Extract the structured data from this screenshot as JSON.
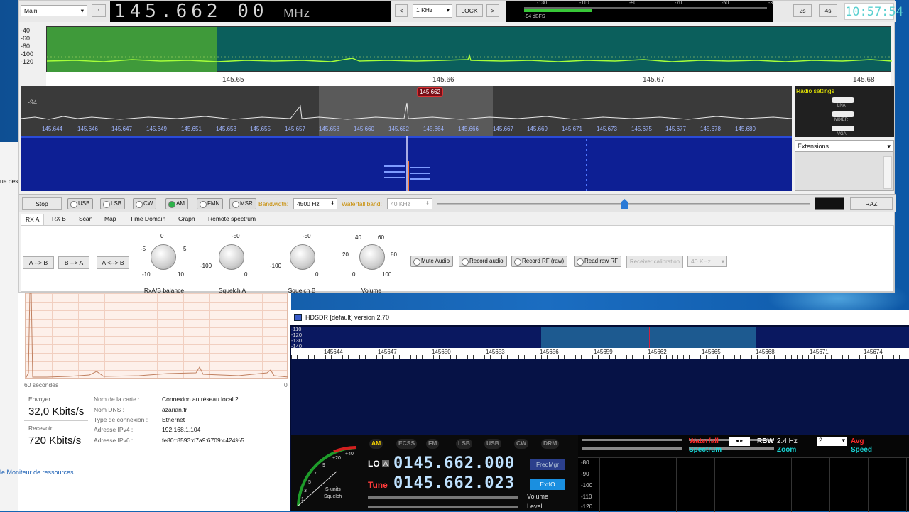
{
  "main_app": {
    "profile_select": "Main",
    "frequency_digits": "145.662 00",
    "frequency_unit": "MHz",
    "step_prev": "<",
    "step_select": "1 KHz",
    "lock_label": "LOCK",
    "step_next": ">",
    "smeter": {
      "scale": [
        "-130",
        "-110",
        "-90",
        "-70",
        "-50",
        "-30"
      ],
      "reading": "-94 dBFS"
    },
    "btn_2s": "2s",
    "btn_4s": "4s",
    "clock": "10:57:54",
    "spectrum1": {
      "y_ticks": [
        "-40",
        "-60",
        "-80",
        "-100",
        "-120"
      ],
      "x_ticks": [
        "145.65",
        "145.66",
        "145.67",
        "145.68"
      ]
    },
    "spectrum2": {
      "level_label": "-94",
      "center_marker": "145.662",
      "x_ticks": [
        "145.644",
        "145.646",
        "145.647",
        "145.649",
        "145.651",
        "145.653",
        "145.655",
        "145.657",
        "145.658",
        "145.660",
        "145.662",
        "145.664",
        "145.666",
        "145.667",
        "145.669",
        "145.671",
        "145.673",
        "145.675",
        "145.677",
        "145.678",
        "145.680"
      ]
    },
    "radio_settings": {
      "title": "Radio settings",
      "items": [
        "LNA",
        "MIXER",
        "VGA"
      ]
    },
    "extensions": "Extensions",
    "controls": {
      "stop": "Stop",
      "modes": [
        "USB",
        "LSB",
        "CW",
        "AM",
        "FMN",
        "MSR"
      ],
      "active_mode": "AM",
      "bandwidth_label": "Bandwidth:",
      "bandwidth_value": "4500 Hz",
      "waterfall_band_label": "Waterfall band:",
      "waterfall_band_value": "40 KHz",
      "raz": "RAZ"
    },
    "tabs": [
      "RX A",
      "RX B",
      "Scan",
      "Map",
      "Time Domain",
      "Graph",
      "Remote spectrum"
    ],
    "rx_buttons": [
      "A --> B",
      "B --> A",
      "A <--> B"
    ],
    "knobs": [
      {
        "label": "RxA/B balance",
        "ticks": [
          "0",
          "-5",
          "5",
          "-10",
          "10"
        ]
      },
      {
        "label": "Squelch A",
        "ticks": [
          "-50",
          "-100",
          "0"
        ]
      },
      {
        "label": "Squelch B",
        "ticks": [
          "-50",
          "-100",
          "0"
        ]
      },
      {
        "label": "Volume",
        "ticks": [
          "40",
          "60",
          "20",
          "80",
          "0",
          "100"
        ]
      }
    ],
    "audio_buttons": [
      "Mute Audio",
      "Record audio",
      "Record RF (raw)",
      "Read raw RF",
      "Receiver calibration",
      "40 KHz"
    ]
  },
  "resource_monitor": {
    "left_cut_label": "ue des",
    "graph_seconds": "60 secondes",
    "graph_zero": "0",
    "send_label": "Envoyer",
    "send_value": "32,0 Kbits/s",
    "receive_label": "Recevoir",
    "receive_value": "720 Kbits/s",
    "info": [
      {
        "k": "Nom de la carte :",
        "v": "Connexion au réseau local 2"
      },
      {
        "k": "Nom DNS :",
        "v": "azarian.fr"
      },
      {
        "k": "Type de connexion :",
        "v": "Ethernet"
      },
      {
        "k": "Adresse IPv4 :",
        "v": "192.168.1.104"
      },
      {
        "k": "Adresse IPv6 :",
        "v": "fe80::8593:d7a9:6709:c424%5"
      }
    ],
    "link": "le Moniteur de ressources"
  },
  "hdsdr": {
    "title": "HDSDR [default]  version 2.70",
    "y_ticks": [
      "-110",
      "-120",
      "-130",
      "-140"
    ],
    "x_ticks": [
      "145644",
      "145647",
      "145650",
      "145653",
      "145656",
      "145659",
      "145662",
      "145665",
      "145668",
      "145671",
      "145674"
    ],
    "modes": [
      "AM",
      "ECSS",
      "FM",
      "LSB",
      "USB",
      "CW",
      "DRM"
    ],
    "active_mode": "AM",
    "lo_label": "LO",
    "lo_a": "A",
    "lo_value": "0145.662.000",
    "tune_label": "Tune",
    "tune_value": "0145.662.023",
    "freqmgr": "FreqMgr",
    "extio": "ExtIO",
    "volume_label": "Volume",
    "level_label": "Level",
    "smeter_ticks": [
      "+20",
      "+40",
      "9",
      "7",
      "5",
      "3",
      "1"
    ],
    "smeter_caption": "S-units",
    "smeter_squelch": "Squelch",
    "waterfall_label": "Waterfall",
    "spectrum_label": "Spectrum",
    "rbw_label": "RBW",
    "rbw_value": "2.4 Hz",
    "zoom_label": "Zoom",
    "avg_label": "Avg",
    "speed_label": "Speed",
    "avg_value": "2",
    "right_y_ticks": [
      "-80",
      "-90",
      "-100",
      "-110",
      "-120"
    ]
  }
}
